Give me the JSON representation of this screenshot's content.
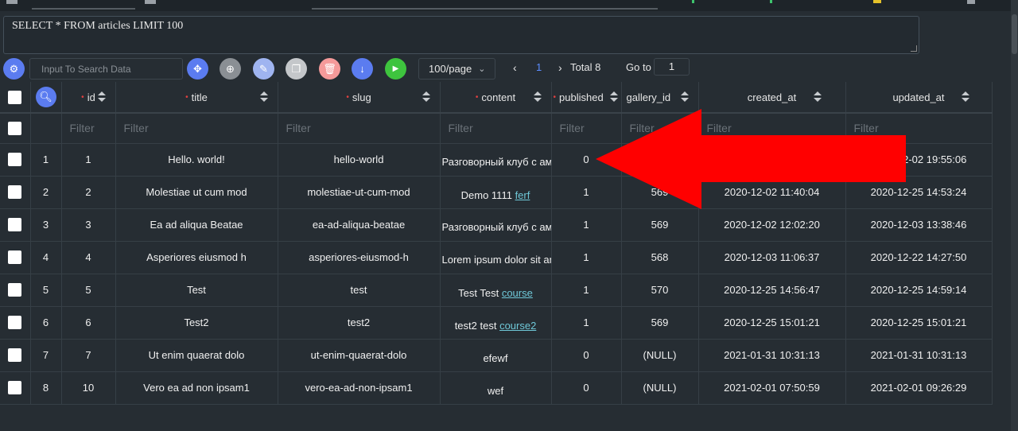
{
  "query": {
    "text": "SELECT * FROM articles LIMIT 100"
  },
  "search": {
    "placeholder": "Input To Search Data"
  },
  "toolbar": {
    "buttons": [
      {
        "icon": "settings-icon",
        "color": "#5b7cf0"
      },
      {
        "icon": "move-icon",
        "color": "#5b7cf0"
      },
      {
        "icon": "add-icon",
        "color": "#8a8f94"
      },
      {
        "icon": "edit-icon",
        "color": "#9fb4f0"
      },
      {
        "icon": "copy-icon",
        "color": "#c4c7ca"
      },
      {
        "icon": "delete-icon",
        "color": "#f59a9a"
      },
      {
        "icon": "export-icon",
        "color": "#5b7cf0"
      },
      {
        "icon": "run-icon",
        "color": "#3ec43e"
      }
    ]
  },
  "pagination": {
    "page_size": "100/page",
    "prev": "‹",
    "current": "1",
    "next": "›",
    "total": "Total 8",
    "goto_label": "Go to",
    "goto_value": "1"
  },
  "columns": [
    {
      "label": "id",
      "required": true
    },
    {
      "label": "title",
      "required": true
    },
    {
      "label": "slug",
      "required": true
    },
    {
      "label": "content",
      "required": true
    },
    {
      "label": "published",
      "required": true
    },
    {
      "label": "gallery_id",
      "required": false
    },
    {
      "label": "created_at",
      "required": false
    },
    {
      "label": "updated_at",
      "required": false
    }
  ],
  "filter_placeholder": "Filter",
  "rows": [
    {
      "n": "1",
      "id": "1",
      "title": "Hello. world!",
      "slug": "hello-world",
      "content": "Разговорный клуб с аме",
      "content_link": "",
      "published": "0",
      "gallery_id": "",
      "created_at": "",
      "updated_at": "2020-12-02 19:55:06"
    },
    {
      "n": "2",
      "id": "2",
      "title": "Molestiae ut cum mod",
      "slug": "molestiae-ut-cum-mod",
      "content": "Demo 1111 ",
      "content_link": "ferf",
      "published": "1",
      "gallery_id": "569",
      "created_at": "2020-12-02 11:40:04",
      "updated_at": "2020-12-25 14:53:24"
    },
    {
      "n": "3",
      "id": "3",
      "title": "Ea ad aliqua Beatae",
      "slug": "ea-ad-aliqua-beatae",
      "content": "Разговорный клуб с аме",
      "content_link": "",
      "published": "1",
      "gallery_id": "569",
      "created_at": "2020-12-02 12:02:20",
      "updated_at": "2020-12-03 13:38:46"
    },
    {
      "n": "4",
      "id": "4",
      "title": "Asperiores eiusmod h",
      "slug": "asperiores-eiusmod-h",
      "content": "Lorem ipsum dolor sit am",
      "content_link": "",
      "published": "1",
      "gallery_id": "568",
      "created_at": "2020-12-03 11:06:37",
      "updated_at": "2020-12-22 14:27:50"
    },
    {
      "n": "5",
      "id": "5",
      "title": "Test",
      "slug": "test",
      "content": "Test Test ",
      "content_link": "course",
      "published": "1",
      "gallery_id": "570",
      "created_at": "2020-12-25 14:56:47",
      "updated_at": "2020-12-25 14:59:14"
    },
    {
      "n": "6",
      "id": "6",
      "title": "Test2",
      "slug": "test2",
      "content": "test2 test ",
      "content_link": "course2",
      "published": "1",
      "gallery_id": "569",
      "created_at": "2020-12-25 15:01:21",
      "updated_at": "2020-12-25 15:01:21"
    },
    {
      "n": "7",
      "id": "7",
      "title": "Ut enim quaerat dolo",
      "slug": "ut-enim-quaerat-dolo",
      "content": "efewf",
      "content_link": "",
      "published": "0",
      "gallery_id": "(NULL)",
      "created_at": "2021-01-31 10:31:13",
      "updated_at": "2021-01-31 10:31:13"
    },
    {
      "n": "8",
      "id": "10",
      "title": "Vero ea ad non ipsam1",
      "slug": "vero-ea-ad-non-ipsam1",
      "content": "wef",
      "content_link": "",
      "published": "0",
      "gallery_id": "(NULL)",
      "created_at": "2021-02-01 07:50:59",
      "updated_at": "2021-02-01 09:26:29"
    }
  ],
  "annotation": {
    "arrow_color": "#ff0000"
  }
}
